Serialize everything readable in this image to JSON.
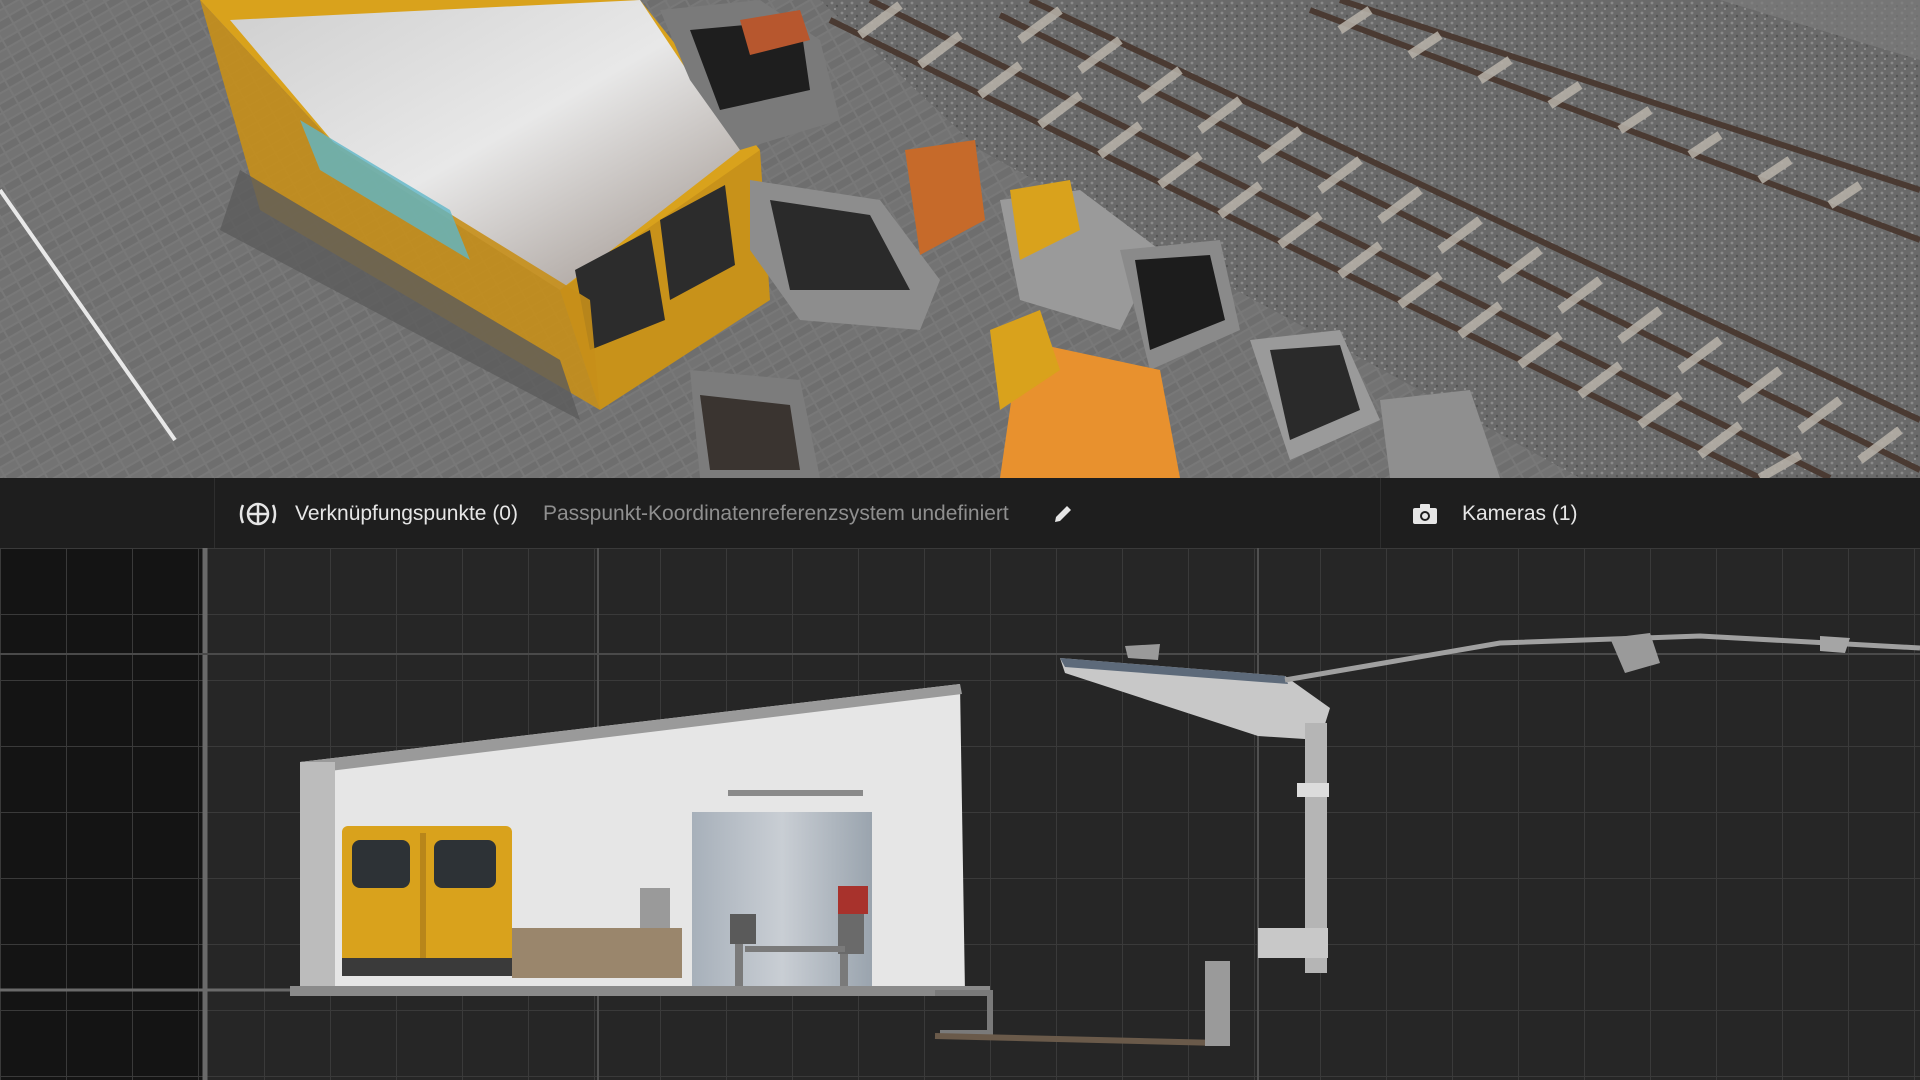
{
  "toolbar": {
    "tie_points_label": "Verknüpfungspunkte (0)",
    "crs_status": "Passpunkt-Koordinatenreferenzsystem undefiniert",
    "cameras_label": "Kameras (1)",
    "icons": {
      "tie_points": "crosshair-target-icon",
      "edit": "pencil-icon",
      "cameras": "camera-icon"
    }
  },
  "colors": {
    "background": "#1c1c1c",
    "panel": "#1e1e1e",
    "grid_line": "#3a3a3a",
    "primary_text": "#e6e6e6",
    "secondary_text": "#8f8f8f",
    "machine_yellow": "#d9a21c"
  },
  "viewports": {
    "top": "orthophoto-3d-view",
    "bottom": "cross-section-view"
  }
}
